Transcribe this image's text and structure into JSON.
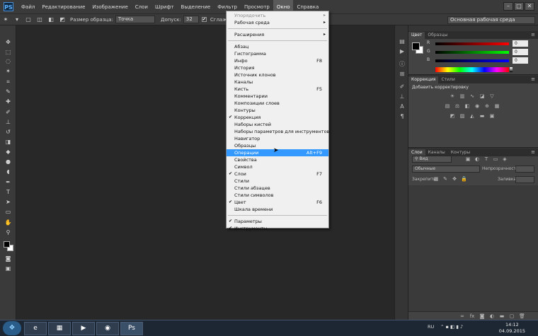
{
  "app": {
    "logo": "PS",
    "menus": [
      "Файл",
      "Редактирование",
      "Изображение",
      "Слои",
      "Шрифт",
      "Выделение",
      "Фильтр",
      "Просмотр",
      "Окно",
      "Справка"
    ],
    "active_menu": "Окно",
    "window_controls": [
      "–",
      "□",
      "✕"
    ]
  },
  "options_bar": {
    "sample_size_label": "Размер образца:",
    "sample_size_value": "Точка",
    "tolerance_label": "Допуск:",
    "tolerance_value": "32",
    "antialias_label": "Сглаживание",
    "workspace": "Основная рабочая среда"
  },
  "window_menu": {
    "items": [
      {
        "label": "Упорядочить",
        "submenu": true,
        "disabled": true
      },
      {
        "label": "Рабочая среда",
        "submenu": true
      },
      {
        "sep": true
      },
      {
        "label": "Расширения",
        "submenu": true
      },
      {
        "sep": true
      },
      {
        "label": "Абзац"
      },
      {
        "label": "Гистограмма"
      },
      {
        "label": "Инфо",
        "shortcut": "F8"
      },
      {
        "label": "История"
      },
      {
        "label": "Источник клонов"
      },
      {
        "label": "Каналы"
      },
      {
        "label": "Кисть",
        "shortcut": "F5"
      },
      {
        "label": "Комментарии"
      },
      {
        "label": "Композиции слоев"
      },
      {
        "label": "Контуры"
      },
      {
        "label": "Коррекция",
        "checked": true
      },
      {
        "label": "Наборы кистей"
      },
      {
        "label": "Наборы параметров для инструментов"
      },
      {
        "label": "Навигатор"
      },
      {
        "label": "Образцы"
      },
      {
        "label": "Операции",
        "shortcut": "Alt+F9",
        "highlighted": true
      },
      {
        "label": "Свойства"
      },
      {
        "label": "Символ"
      },
      {
        "label": "Слои",
        "shortcut": "F7",
        "checked": true
      },
      {
        "label": "Стили"
      },
      {
        "label": "Стили абзацев"
      },
      {
        "label": "Стили символов"
      },
      {
        "label": "Цвет",
        "shortcut": "F6",
        "checked": true
      },
      {
        "label": "Шкала времени"
      },
      {
        "sep": true
      },
      {
        "label": "Параметры",
        "checked": true
      },
      {
        "label": "Инструменты",
        "checked": true
      }
    ]
  },
  "color_panel": {
    "tabs": [
      "Цвет",
      "Образцы"
    ],
    "channels": [
      {
        "label": "R",
        "value": "0",
        "gradient": "linear-gradient(to right,#000,#ff0000)"
      },
      {
        "label": "G",
        "value": "0",
        "gradient": "linear-gradient(to right,#000,#00ff00)"
      },
      {
        "label": "B",
        "value": "0",
        "gradient": "linear-gradient(to right,#000,#0000ff)"
      }
    ]
  },
  "adjustments_panel": {
    "tabs": [
      "Коррекция",
      "Стили"
    ],
    "heading": "Добавить корректировку"
  },
  "layers_panel": {
    "tabs": [
      "Слои",
      "Каналы",
      "Контуры"
    ],
    "kind": "Вид",
    "blend_mode": "Обычные",
    "opacity_label": "Непрозрачность:",
    "lock_label": "Закрепить:",
    "fill_label": "Заливка:"
  },
  "taskbar": {
    "language": "RU",
    "time": "14:12",
    "date": "04.09.2015"
  }
}
